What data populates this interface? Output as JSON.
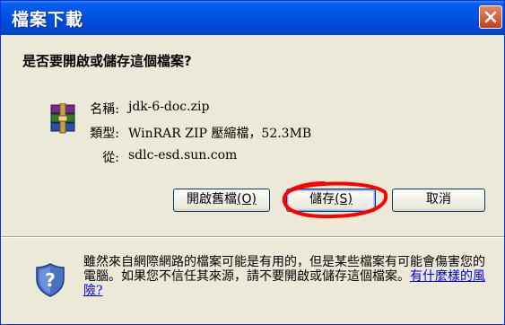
{
  "dialog": {
    "title": "檔案下載",
    "question": "是否要開啟或儲存這個檔案?"
  },
  "file": {
    "icon": "winrar-archive-icon",
    "name_label": "名稱:",
    "name": "jdk-6-doc.zip",
    "type_label": "類型:",
    "type": "WinRAR ZIP 壓縮檔，52.3MB",
    "from_label": "從:",
    "from": "sdlc-esd.sun.com"
  },
  "buttons": {
    "open": "開啟舊檔",
    "open_key": "(O)",
    "save": "儲存",
    "save_key": "(S)",
    "cancel": "取消"
  },
  "warning": {
    "icon": "security-shield-icon",
    "text": "雖然來自網際網路的檔案可能是有用的，但是某些檔案有可能會傷害您的電腦。如果您不信任其來源，請不要開啟或儲存這個檔案。",
    "link": "有什麼樣的風險?"
  },
  "colors": {
    "titlebar": "#0054e3",
    "annotation": "#ff0000"
  }
}
